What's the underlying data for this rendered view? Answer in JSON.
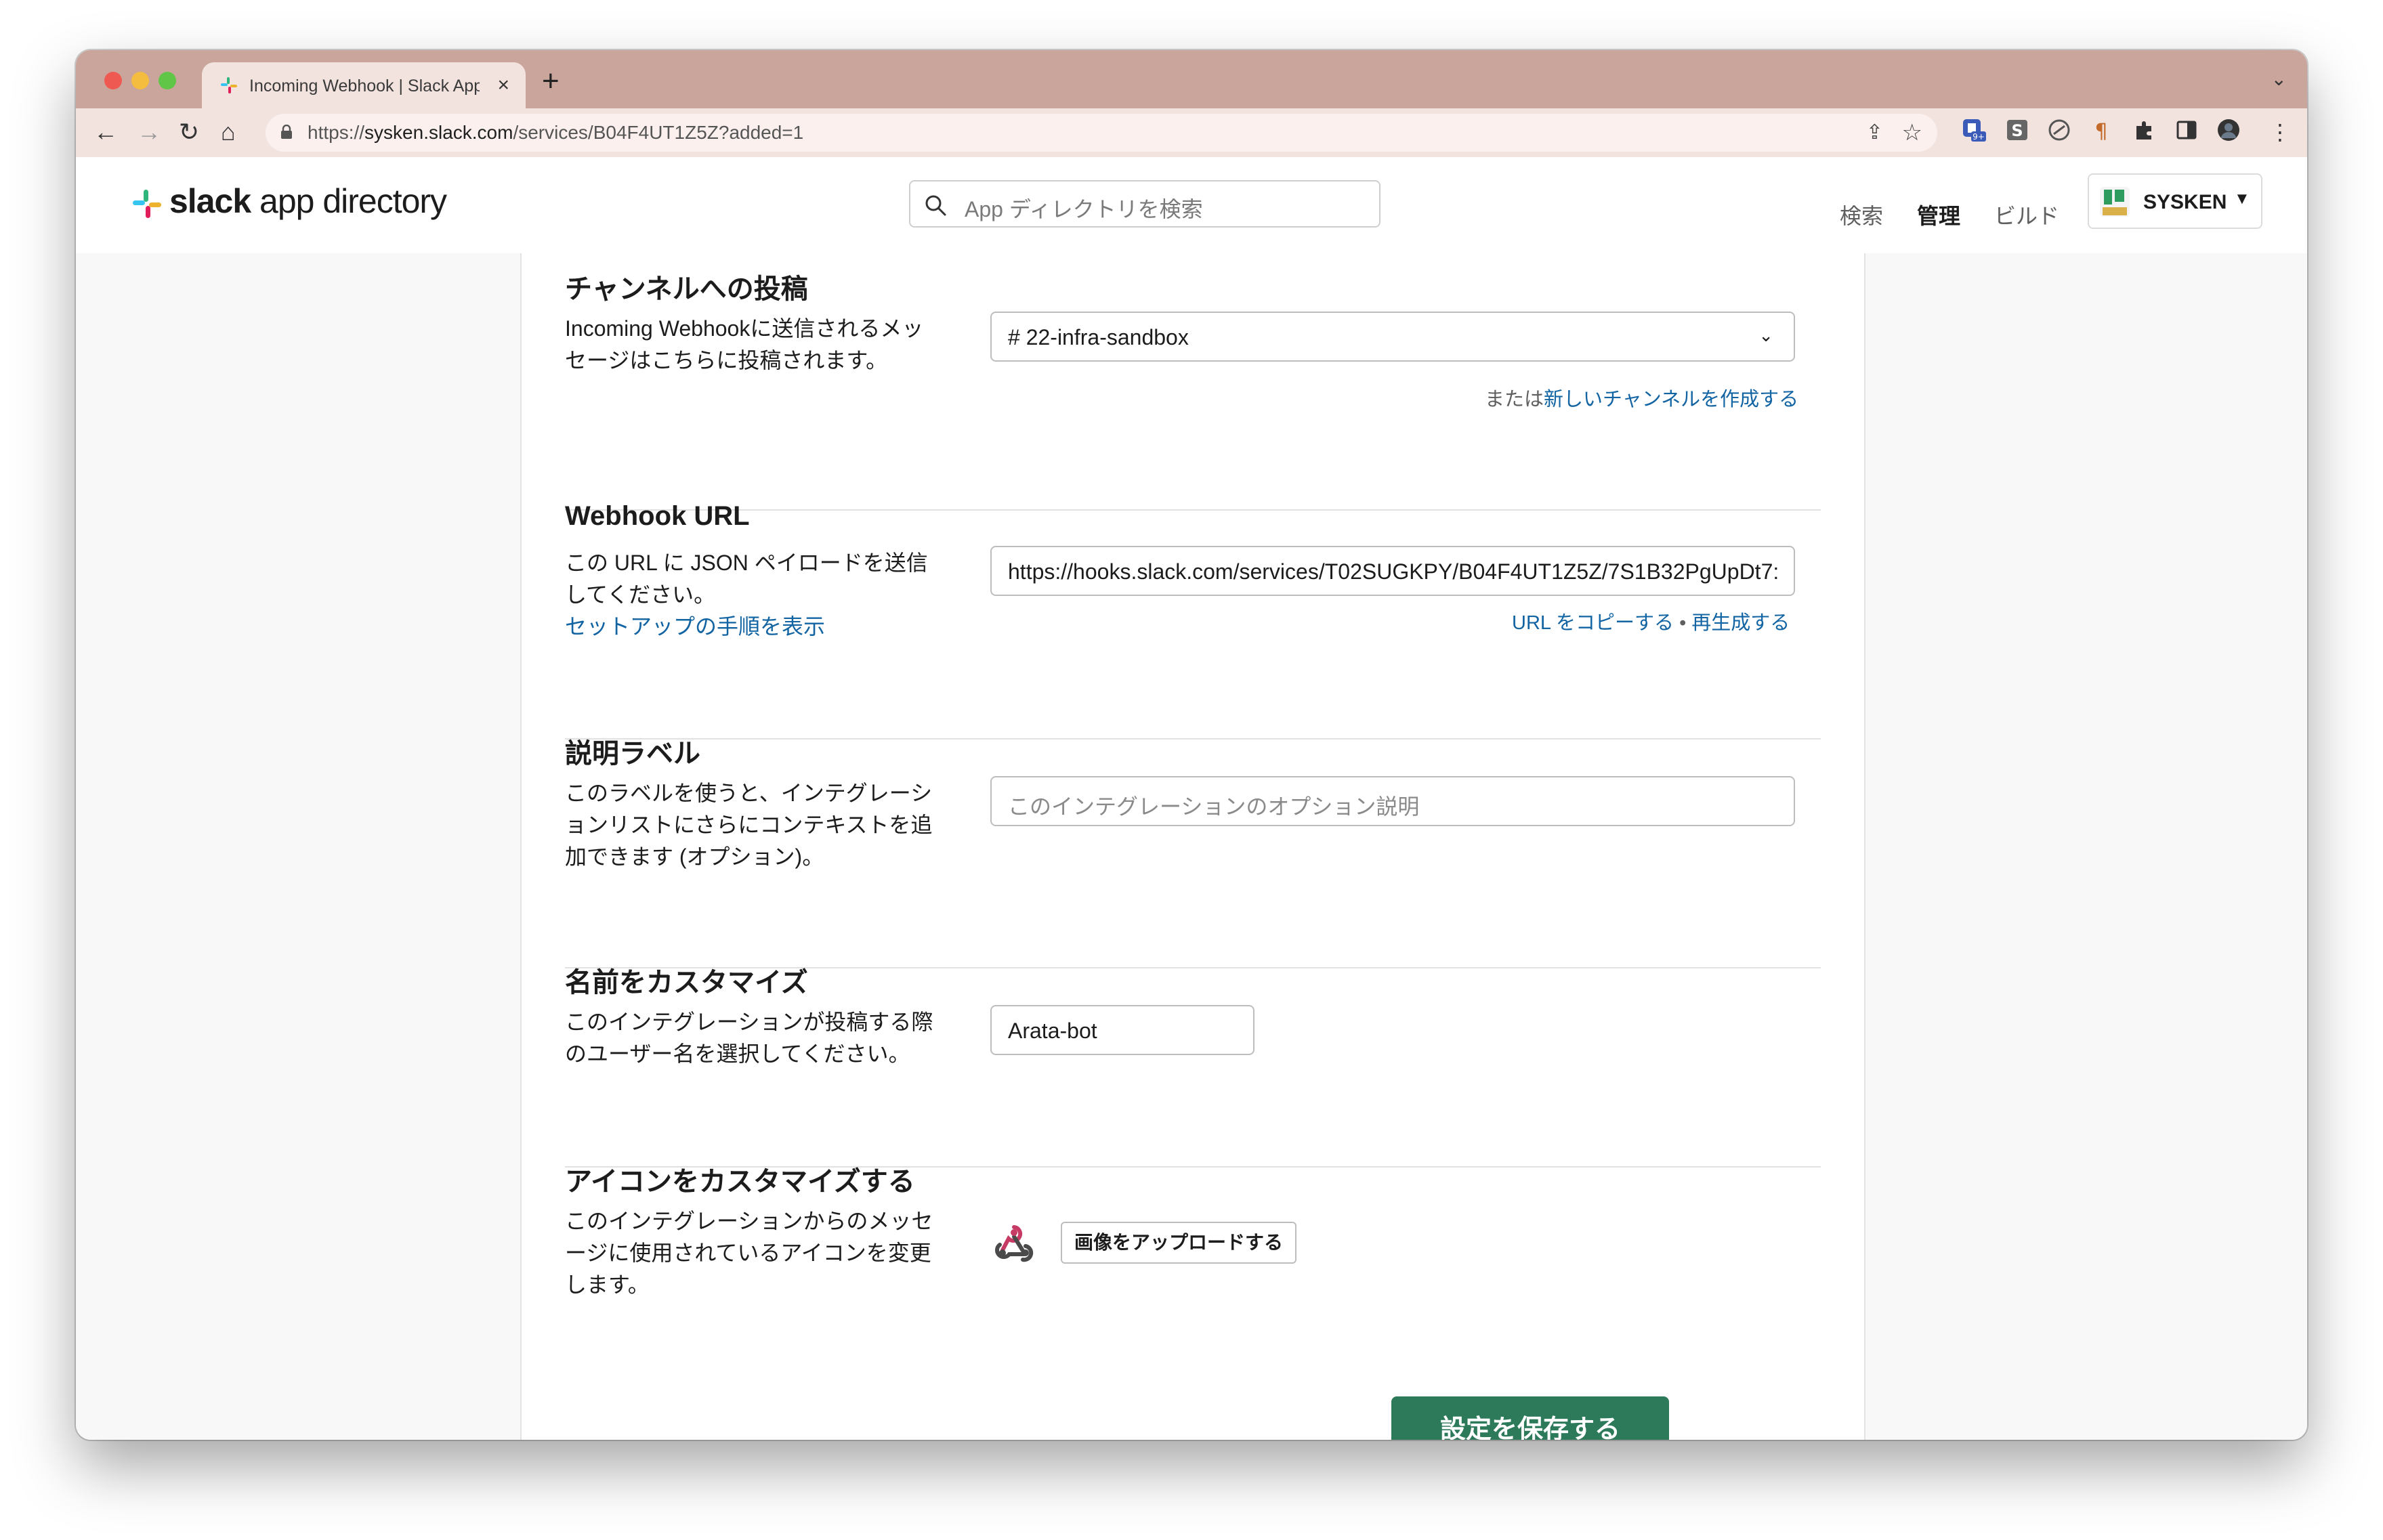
{
  "browser": {
    "tab_title": "Incoming Webhook | Slack App",
    "new_tab_label": "+",
    "url_prefix": "https://",
    "url_host": "sysken.slack.com",
    "url_path": "/services/B04F4UT1Z5Z?added=1",
    "badge_count": "9+"
  },
  "header": {
    "logo_bold": "slack",
    "logo_rest": " app directory",
    "search_placeholder": "App ディレクトリを検索",
    "nav": [
      "検索",
      "管理",
      "ビルド"
    ],
    "workspace": "SYSKEN"
  },
  "sections": {
    "channel": {
      "title": "チャンネルへの投稿",
      "desc": "Incoming Webhookに送信されるメッセージはこちらに投稿されます。",
      "selected_channel": "# 22-infra-sandbox",
      "helper_prefix": "または",
      "helper_link": "新しいチャンネルを作成する"
    },
    "webhook": {
      "title": "Webhook URL",
      "desc": "この URL に JSON ペイロードを送信してください。",
      "setup_link": "セットアップの手順を表示",
      "url_value": "https://hooks.slack.com/services/T02SUGKPY/B04F4UT1Z5Z/7S1B32PgUpDt7:",
      "copy_link": "URL をコピーする",
      "separator": "•",
      "regen_link": "再生成する"
    },
    "label": {
      "title": "説明ラベル",
      "desc": "このラベルを使うと、インテグレーションリストにさらにコンテキストを追加できます (オプション)。",
      "placeholder": "このインテグレーションのオプション説明"
    },
    "name": {
      "title": "名前をカスタマイズ",
      "desc": "このインテグレーションが投稿する際のユーザー名を選択してください。",
      "value": "Arata-bot"
    },
    "icon": {
      "title": "アイコンをカスタマイズする",
      "desc": "このインテグレーションからのメッセージに使用されているアイコンを変更します。",
      "upload_label": "画像をアップロードする"
    }
  },
  "save_label": "設定を保存する",
  "colors": {
    "link": "#1264a3",
    "save_button": "#2c7a5a",
    "tab_strip": "#c9a59c"
  }
}
